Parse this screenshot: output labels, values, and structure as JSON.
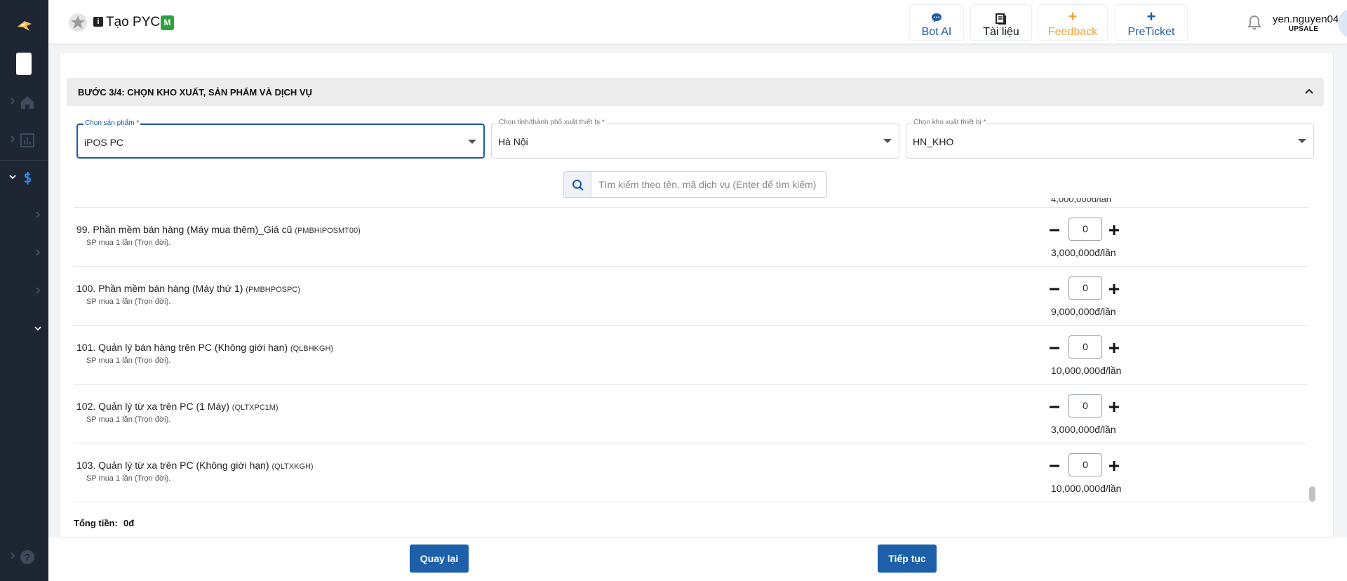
{
  "header": {
    "title": "Tạo PYC",
    "badge": "M",
    "buttons": [
      {
        "label": "Bot AI",
        "color": "#1f5aa8"
      },
      {
        "label": "Tài liệu",
        "color": "#111111"
      },
      {
        "label": "Feedback",
        "color": "#f0a23b"
      },
      {
        "label": "PreTicket",
        "color": "#1f5aa8"
      }
    ],
    "user": {
      "name": "yen.nguyen04",
      "role": "UPSALE"
    }
  },
  "step": {
    "title": "BƯỚC 3/4: CHỌN KHO XUẤT, SẢN PHẨM VÀ DỊCH VỤ"
  },
  "fields": [
    {
      "label": "Chọn sản phẩm *",
      "value": "iPOS PC"
    },
    {
      "label": "Chọn tỉnh/thành phố xuất thiết bị *",
      "value": "Hà Nội"
    },
    {
      "label": "Chọn kho xuất thiết bị *",
      "value": "HN_KHO"
    }
  ],
  "search": {
    "placeholder": "Tìm kiếm theo tên, mã dịch vụ (Enter để tìm kiếm)"
  },
  "cut_price": "4,000,000đ/lần",
  "items": [
    {
      "name": "99. Phần mềm bán hàng (Máy mua thêm)_Giá cũ",
      "code": "(PMBHIPOSMT00)",
      "note": "SP mua 1 lần (Trọn đời).",
      "qty": "0",
      "price": "3,000,000đ/lần"
    },
    {
      "name": "100. Phần mềm bán hàng (Máy thứ 1)",
      "code": "(PMBHPOSPC)",
      "note": "SP mua 1 lần (Trọn đời).",
      "qty": "0",
      "price": "9,000,000đ/lần"
    },
    {
      "name": "101. Quản lý bán hàng trên PC (Không giới hạn)",
      "code": "(QLBHKGH)",
      "note": "SP mua 1 lần (Trọn đời).",
      "qty": "0",
      "price": "10,000,000đ/lần"
    },
    {
      "name": "102. Quản lý từ xa trên PC (1 Máy)",
      "code": "(QLTXPC1M)",
      "note": "SP mua 1 lần (Trọn đời).",
      "qty": "0",
      "price": "3,000,000đ/lần"
    },
    {
      "name": "103. Quản lý từ xa trên PC (Không giới hạn)",
      "code": "(QLTXKGH)",
      "note": "SP mua 1 lần (Trọn đời).",
      "qty": "0",
      "price": "10,000,000đ/lần"
    }
  ],
  "total": {
    "label": "Tổng tiền:",
    "value": "0đ"
  },
  "actions": {
    "back": "Quay lại",
    "next": "Tiếp tục"
  },
  "colors": {
    "primary": "#1d5fa8",
    "sidebar": "#1f2633",
    "accent_orange": "#f0a23b",
    "badge_green": "#2ea043"
  }
}
